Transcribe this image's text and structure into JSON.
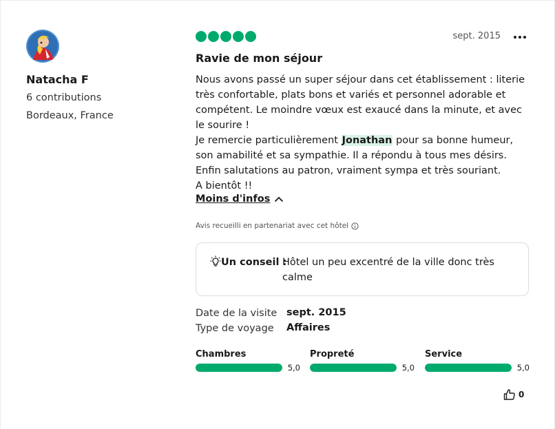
{
  "reviewer": {
    "name": "Natacha F",
    "contributions": "6 contributions",
    "location": "Bordeaux, France"
  },
  "review": {
    "bubble_rating": 5,
    "date": "sept. 2015",
    "title": "Ravie de mon séjour",
    "text_p1": "Nous avons passé un super séjour dans cet établissement : literie très confortable, plats bons et variés et personnel adorable et compétent. Le moindre vœux est exaucé dans la minute, et avec le sourire !",
    "text_p2_before": "Je remercie particulièrement ",
    "text_p2_highlight": "Jonathan",
    "text_p2_after": " pour sa bonne humeur, son amabilité et sa sympathie. Il a répondu à tous mes désirs.",
    "text_p3": "Enfin salutations au patron, vraiment sympa et très souriant.",
    "text_p4": "A bientôt !!",
    "less_label": "Moins d'infos",
    "partner_note": "Avis recueilli en partenariat avec cet hôtel"
  },
  "tip": {
    "label": "Un conseil :",
    "text": "Hôtel un peu excentré de la ville donc très calme"
  },
  "visit": {
    "date_label": "Date de la visite",
    "date_value": "sept. 2015",
    "trip_label": "Type de voyage",
    "trip_value": "Affaires"
  },
  "ratings": [
    {
      "name": "Chambres",
      "value": "5,0",
      "fraction": 1.0
    },
    {
      "name": "Propreté",
      "value": "5,0",
      "fraction": 1.0
    },
    {
      "name": "Service",
      "value": "5,0",
      "fraction": 1.0
    }
  ],
  "helpful": {
    "count": "0"
  },
  "icons": {
    "more": "more-options-icon",
    "chevron": "chevron-up-icon",
    "info": "info-icon",
    "tip": "lightbulb-icon",
    "helpful": "thumbs-up-icon"
  },
  "colors": {
    "accent": "#00aa6c",
    "highlight": "#d9f2e6"
  }
}
